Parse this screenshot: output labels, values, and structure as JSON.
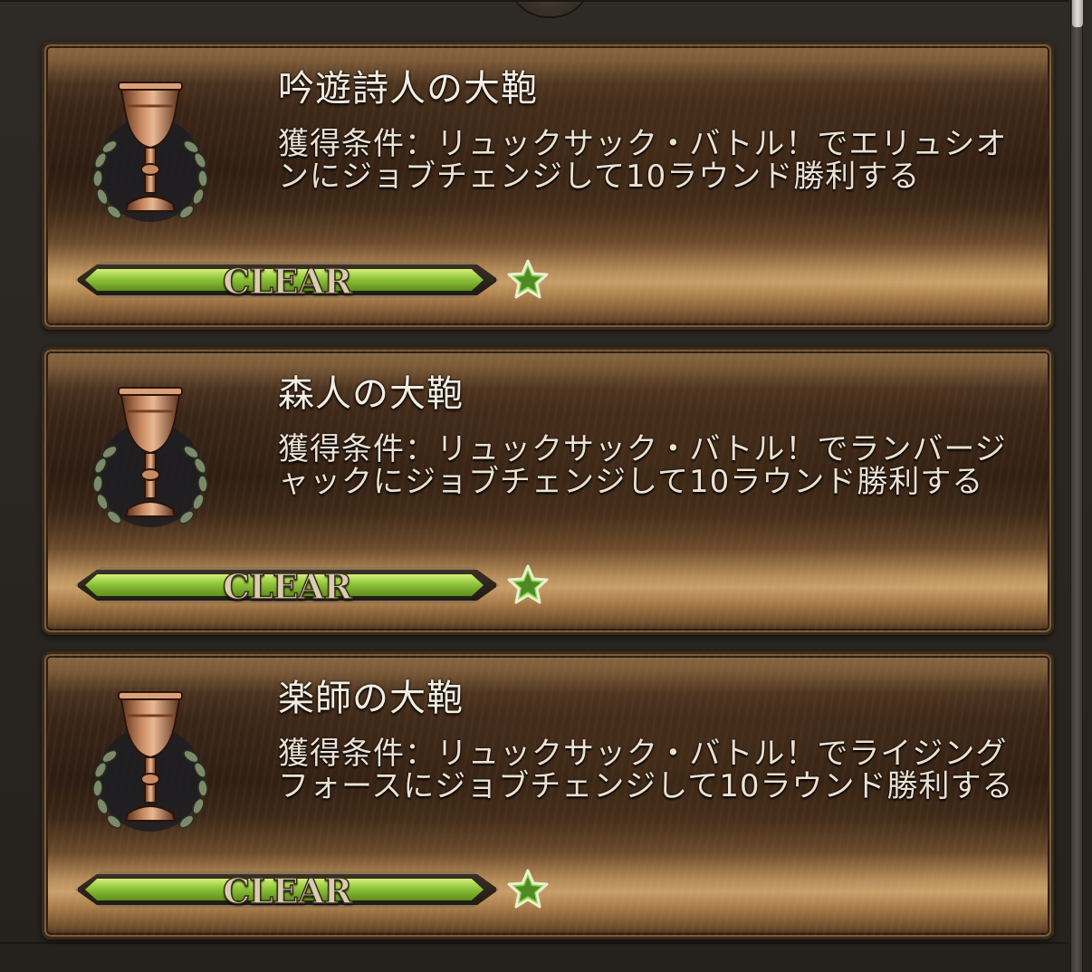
{
  "achievements": [
    {
      "title": "吟遊詩人の大鞄",
      "description": "獲得条件：リュックサック・バトル！でエリュシオンにジョブチェンジして10ラウンド勝利する",
      "status": "CLEAR",
      "progress": 1.0,
      "stars": 1
    },
    {
      "title": "森人の大鞄",
      "description": "獲得条件：リュックサック・バトル！でランバージャックにジョブチェンジして10ラウンド勝利する",
      "status": "CLEAR",
      "progress": 1.0,
      "stars": 1
    },
    {
      "title": "楽師の大鞄",
      "description": "獲得条件：リュックサック・バトル！でライジングフォースにジョブチェンジして10ラウンド勝利する",
      "status": "CLEAR",
      "progress": 1.0,
      "stars": 1
    }
  ],
  "icons": {
    "trophy": "goblet-laurel-icon",
    "star": "star-icon"
  },
  "colors": {
    "progress_fill": "#8fc43a",
    "star": "#8fd14f",
    "title_text": "#f4ede2",
    "card_frame": "#7a5a36"
  }
}
